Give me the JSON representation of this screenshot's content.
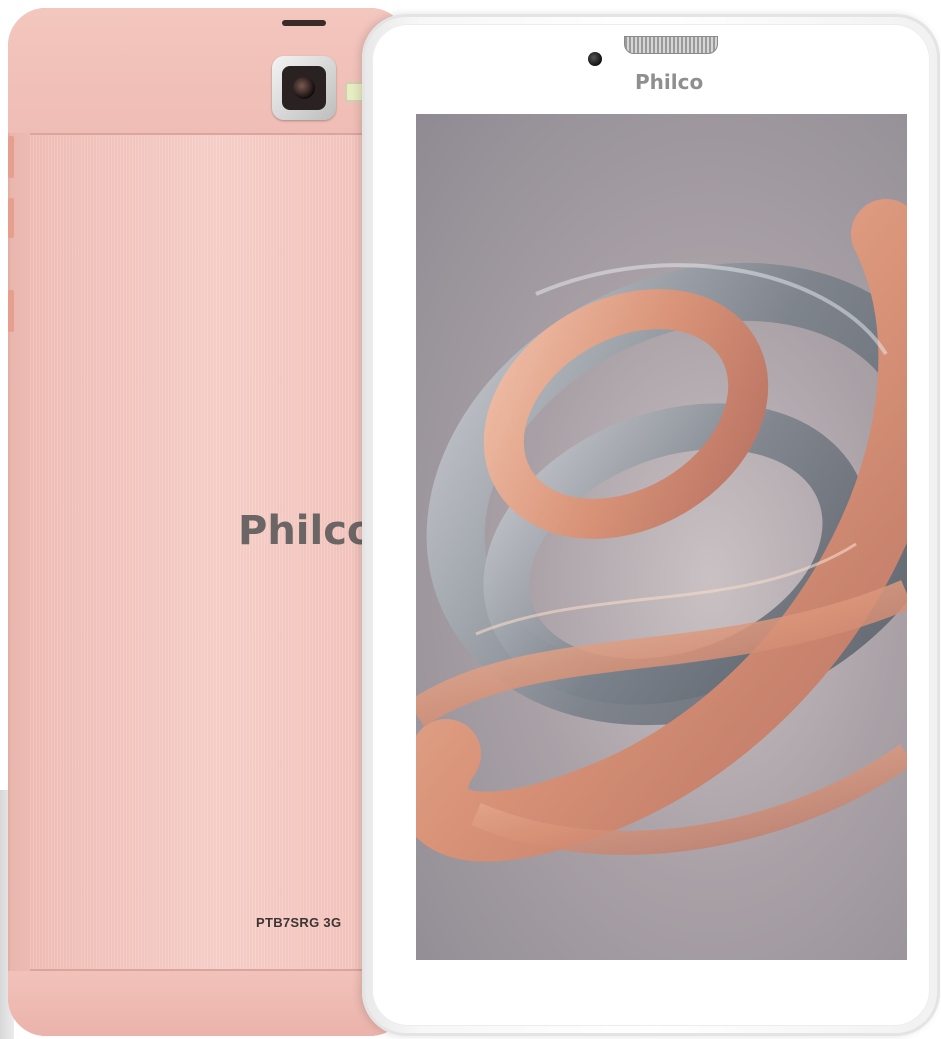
{
  "back": {
    "logo": "Philco",
    "model": "PTB7SRG 3G"
  },
  "front": {
    "logo": "Philco"
  },
  "colors": {
    "rose_gold": "#f2c4bc",
    "bezel": "#ffffff",
    "logo_grey": "#6b6565",
    "ribbon_copper": "#d9977f",
    "ribbon_silver": "#8d9299"
  },
  "icons": [
    "camera-icon",
    "flash-icon",
    "front-camera-icon",
    "speaker-grille-icon"
  ]
}
